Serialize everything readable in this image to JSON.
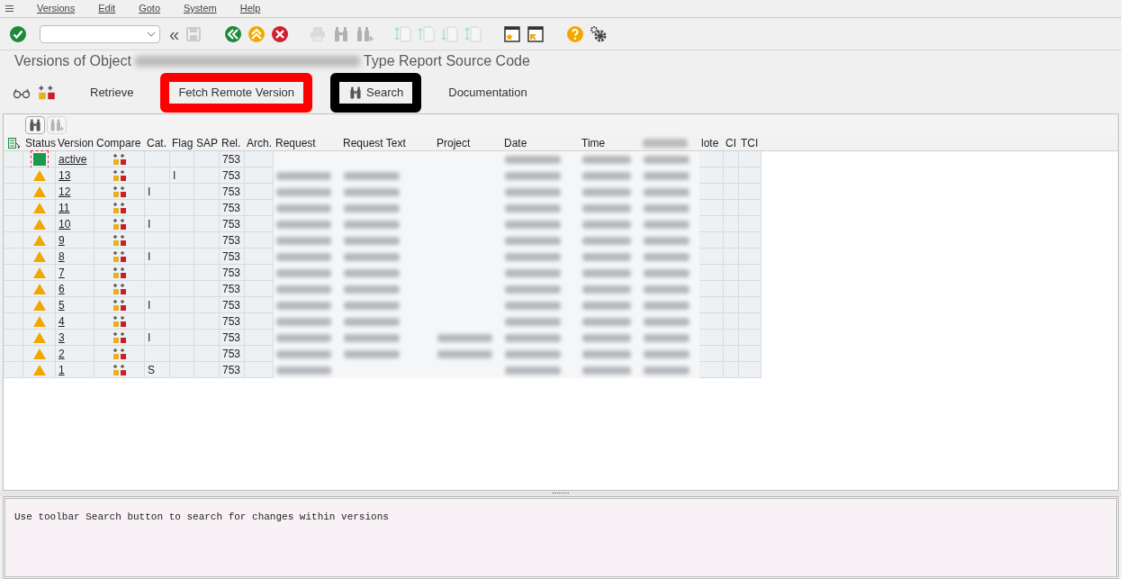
{
  "menu": [
    "Versions",
    "Edit",
    "Goto",
    "System",
    "Help"
  ],
  "toolbar": [
    {
      "kind": "enter",
      "disabled": false
    },
    {
      "kind": "command-field",
      "disabled": false
    },
    {
      "kind": "history",
      "label": "«",
      "disabled": false
    },
    {
      "kind": "save",
      "disabled": true
    },
    {
      "kind": "back",
      "disabled": false
    },
    {
      "kind": "exit",
      "disabled": false
    },
    {
      "kind": "cancel",
      "disabled": false
    },
    {
      "kind": "print",
      "disabled": true
    },
    {
      "kind": "find",
      "disabled": true
    },
    {
      "kind": "find-next",
      "disabled": true
    },
    {
      "kind": "first-page",
      "disabled": true
    },
    {
      "kind": "previous-page",
      "disabled": true
    },
    {
      "kind": "next-page",
      "disabled": true
    },
    {
      "kind": "last-page",
      "disabled": true
    },
    {
      "kind": "new-session",
      "disabled": false
    },
    {
      "kind": "shortcut",
      "disabled": false
    },
    {
      "kind": "help",
      "disabled": false
    },
    {
      "kind": "settings",
      "disabled": false
    }
  ],
  "title": {
    "prefix": "Versions of Object",
    "suffix": "Type Report Source Code"
  },
  "app_toolbar": [
    {
      "kind": "display"
    },
    {
      "kind": "compare"
    },
    {
      "kind": "text",
      "label": "Retrieve"
    },
    {
      "kind": "text",
      "label": "Fetch Remote Version",
      "color": "#ff0000"
    },
    {
      "kind": "search",
      "label": "Search",
      "color": "#000000"
    },
    {
      "kind": "text",
      "label": "Documentation"
    }
  ],
  "grid_toolbar": [
    {
      "kind": "find",
      "disabled": false
    },
    {
      "kind": "find-next",
      "disabled": true
    }
  ],
  "table": {
    "columns": [
      {
        "label": "Status"
      },
      {
        "label": "Version"
      },
      {
        "label": "Compare"
      },
      {
        "label": "Cat."
      },
      {
        "label": "Flag"
      },
      {
        "label": "SAP"
      },
      {
        "label": "Rel."
      },
      {
        "label": "Arch."
      },
      {
        "label": "Request"
      },
      {
        "label": "Request Text"
      },
      {
        "label": "Project"
      },
      {
        "label": "Date"
      },
      {
        "label": "Time"
      },
      {
        "redacted": true
      },
      {
        "label": "lote"
      },
      {
        "label": "CI"
      },
      {
        "label": "TCI"
      }
    ],
    "rows": [
      {
        "kind": "active",
        "version": "active",
        "cat": "",
        "flag": "",
        "rel": "753",
        "redacted": [
          false,
          false,
          false,
          true,
          true,
          true
        ]
      },
      {
        "kind": "warning",
        "version": "13",
        "cat": "",
        "flag": "I",
        "rel": "753",
        "redacted": [
          true,
          true,
          false,
          true,
          true,
          true
        ]
      },
      {
        "kind": "warning",
        "version": "12",
        "cat": "I",
        "flag": "",
        "rel": "753",
        "redacted": [
          true,
          true,
          false,
          true,
          true,
          true
        ]
      },
      {
        "kind": "warning",
        "version": "11",
        "cat": "",
        "flag": "",
        "rel": "753",
        "redacted": [
          true,
          true,
          false,
          true,
          true,
          true
        ]
      },
      {
        "kind": "warning",
        "version": "10",
        "cat": "I",
        "flag": "",
        "rel": "753",
        "redacted": [
          true,
          true,
          false,
          true,
          true,
          true
        ]
      },
      {
        "kind": "warning",
        "version": "9",
        "cat": "",
        "flag": "",
        "rel": "753",
        "redacted": [
          true,
          true,
          false,
          true,
          true,
          true
        ]
      },
      {
        "kind": "warning",
        "version": "8",
        "cat": "I",
        "flag": "",
        "rel": "753",
        "redacted": [
          true,
          true,
          false,
          true,
          true,
          true
        ]
      },
      {
        "kind": "warning",
        "version": "7",
        "cat": "",
        "flag": "",
        "rel": "753",
        "redacted": [
          true,
          true,
          false,
          true,
          true,
          true
        ]
      },
      {
        "kind": "warning",
        "version": "6",
        "cat": "",
        "flag": "",
        "rel": "753",
        "redacted": [
          true,
          true,
          false,
          true,
          true,
          true
        ]
      },
      {
        "kind": "warning",
        "version": "5",
        "cat": "I",
        "flag": "",
        "rel": "753",
        "redacted": [
          true,
          true,
          false,
          true,
          true,
          true
        ]
      },
      {
        "kind": "warning",
        "version": "4",
        "cat": "",
        "flag": "",
        "rel": "753",
        "redacted": [
          true,
          true,
          false,
          true,
          true,
          true
        ]
      },
      {
        "kind": "warning",
        "version": "3",
        "cat": "I",
        "flag": "",
        "rel": "753",
        "redacted": [
          true,
          true,
          true,
          true,
          true,
          true
        ]
      },
      {
        "kind": "warning",
        "version": "2",
        "cat": "",
        "flag": "",
        "rel": "753",
        "redacted": [
          true,
          true,
          true,
          true,
          true,
          true
        ]
      },
      {
        "kind": "warning",
        "version": "1",
        "cat": "S",
        "flag": "",
        "rel": "753",
        "redacted": [
          true,
          false,
          false,
          true,
          true,
          true
        ]
      }
    ]
  },
  "message": "Use toolbar Search button to search for changes within versions"
}
